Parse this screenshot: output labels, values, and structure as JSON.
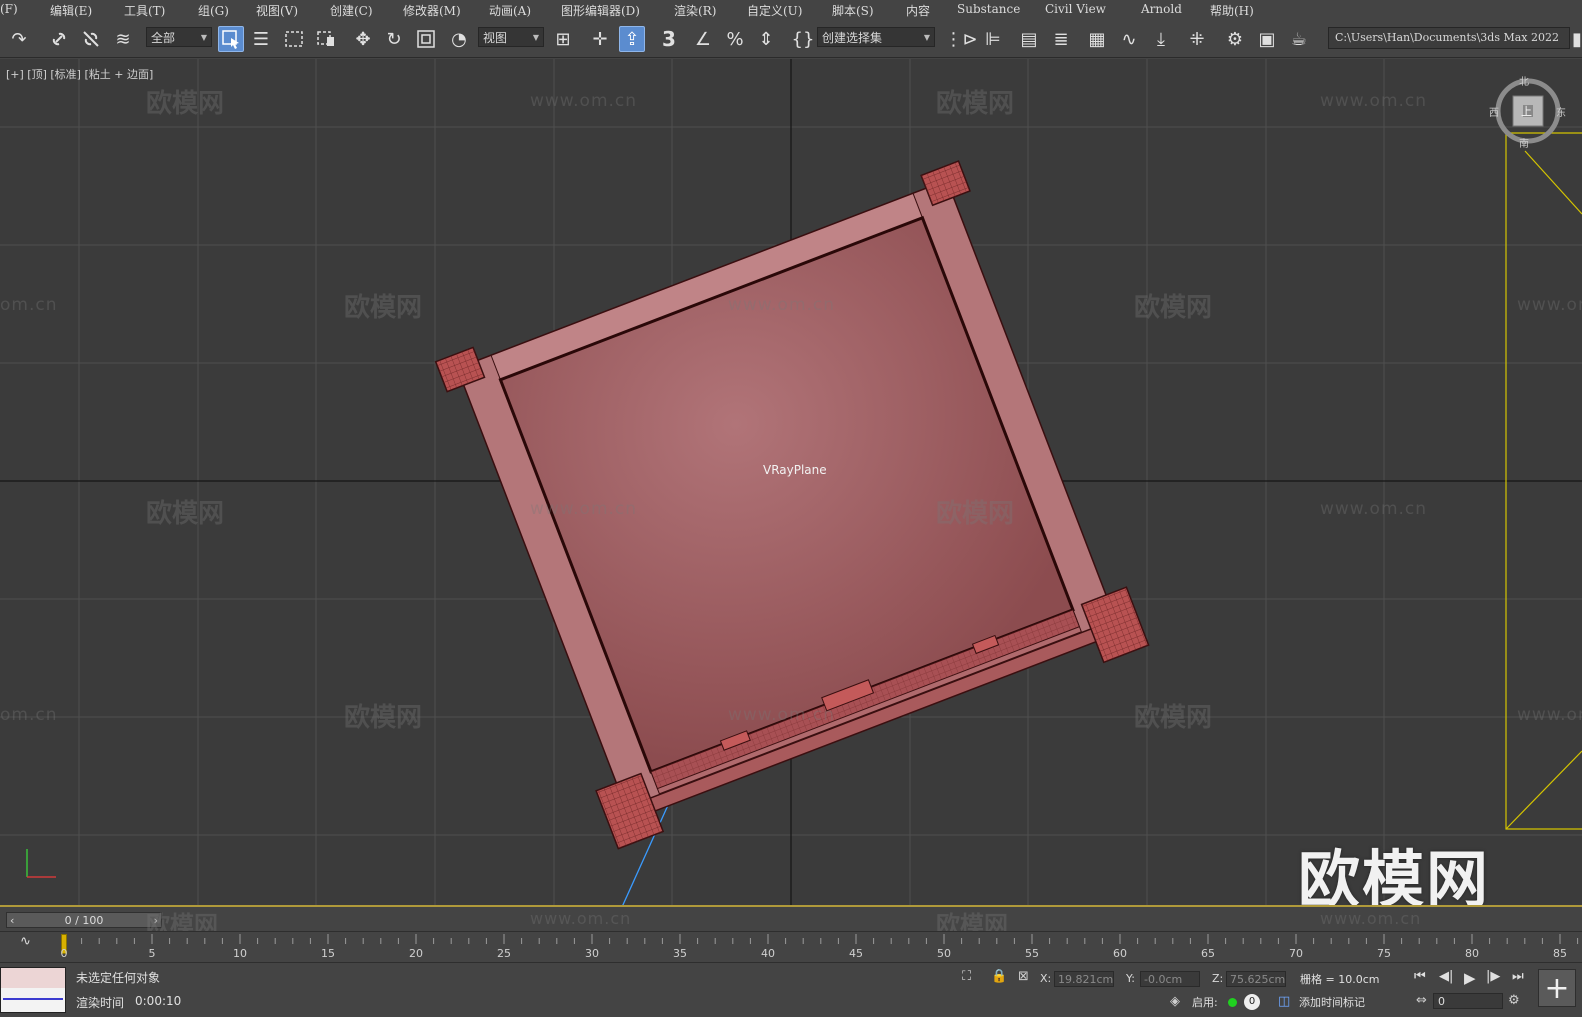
{
  "menu": [
    "(F)",
    "编辑(E)",
    "工具(T)",
    "组(G)",
    "视图(V)",
    "创建(C)",
    "修改器(M)",
    "动画(A)",
    "图形编辑器(D)",
    "渲染(R)",
    "自定义(U)",
    "脚本(S)",
    "内容",
    "Substance",
    "Civil View",
    "Arnold",
    "帮助(H)"
  ],
  "toolbar": {
    "filter_value": "全部",
    "ref_coord_value": "视图",
    "selection_set_placeholder": "创建选择集",
    "project_path": "C:\\Users\\Han\\Documents\\3ds Max 2022",
    "snap_label": "3"
  },
  "viewport": {
    "label": "[+] [顶] [标准] [粘土 + 边面]",
    "object_label": "VRayPlane",
    "watermark_text": "欧模网",
    "watermark_url": "www.om.cn",
    "watermark_url_short": "om.cn",
    "big_watermark": "欧模网",
    "viewcube": {
      "north": "北",
      "west": "西",
      "east": "东",
      "south": "南",
      "face": "上"
    },
    "object_color": "#a5565a",
    "grid_color": "#4f4f4f"
  },
  "timeslider": {
    "value": "0 / 100"
  },
  "trackbar": {
    "ticks": [
      "0",
      "5",
      "10",
      "15",
      "20",
      "25",
      "30",
      "35",
      "40",
      "45",
      "50",
      "55",
      "60",
      "65",
      "70",
      "75",
      "80",
      "85"
    ]
  },
  "status": {
    "selection": "未选定任何对象",
    "render_time_label": "渲染时间",
    "render_time_value": "0:00:10",
    "x_label": "X:",
    "x_value": "19.821cm",
    "y_label": "Y:",
    "y_value": "-0.0cm",
    "z_label": "Z:",
    "z_value": "75.625cm",
    "grid_label": "栅格 = 10.0cm",
    "enable_label": "启用:",
    "enable_count": "0",
    "add_time_tag": "添加时间标记",
    "frame_value": "0"
  }
}
